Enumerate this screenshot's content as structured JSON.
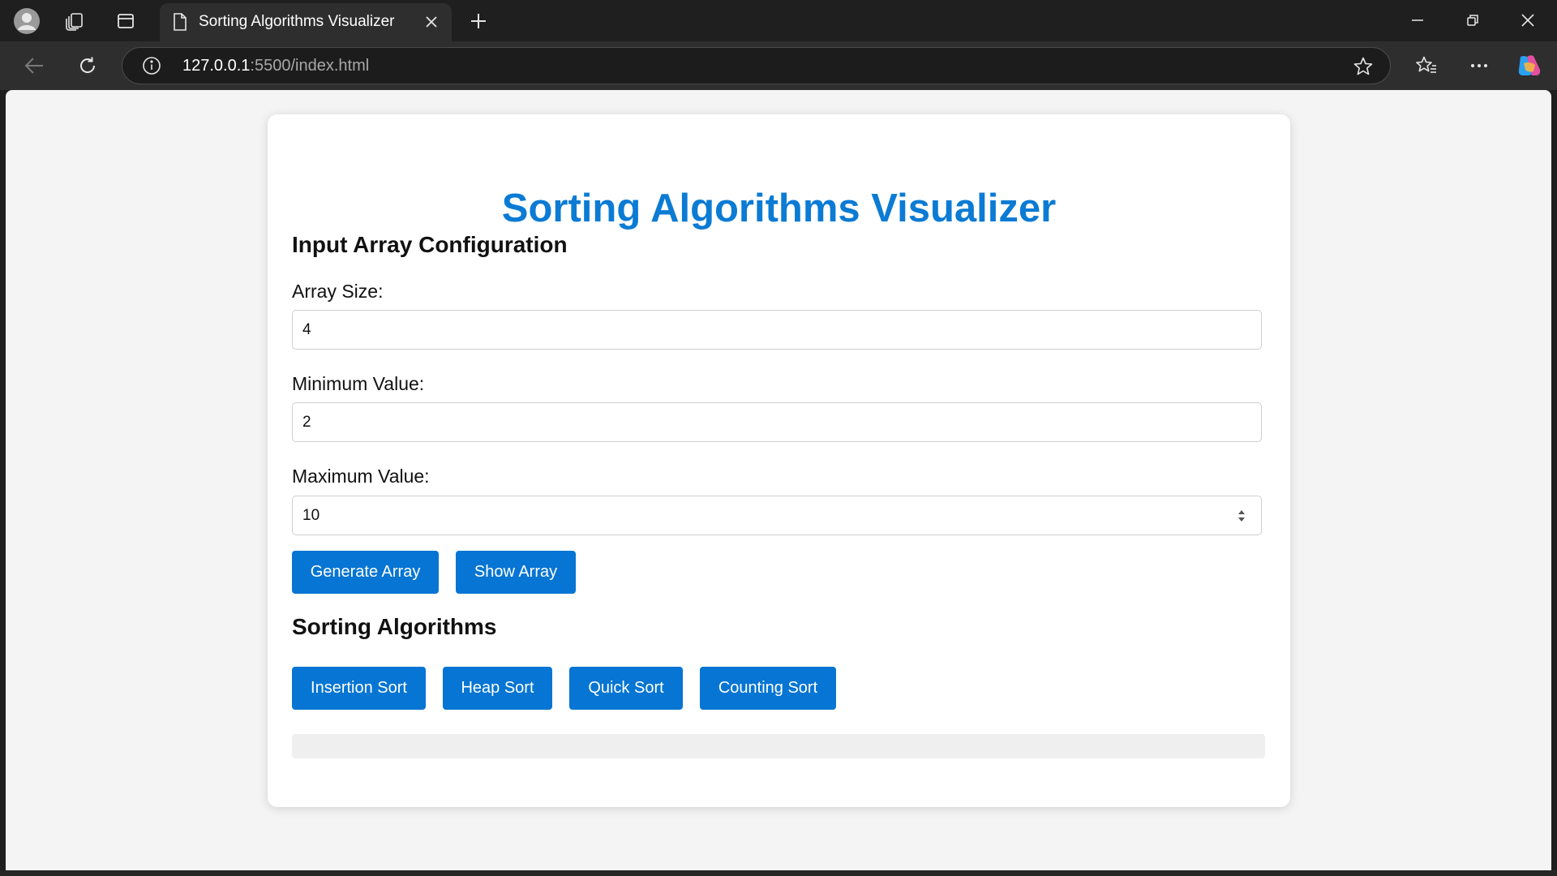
{
  "browser": {
    "tab": {
      "title": "Sorting Algorithms Visualizer"
    },
    "address": {
      "host": "127.0.0.1",
      "path": ":5500/index.html"
    }
  },
  "page": {
    "title": "Sorting Algorithms Visualizer",
    "config_section": "Input Array Configuration",
    "array_size": {
      "label": "Array Size:",
      "value": "4"
    },
    "min_value": {
      "label": "Minimum Value:",
      "value": "2"
    },
    "max_value": {
      "label": "Maximum Value:",
      "value": "10"
    },
    "actions": {
      "generate": "Generate Array",
      "show": "Show Array"
    },
    "algorithms_section": "Sorting Algorithms",
    "algorithms": {
      "insertion": "Insertion Sort",
      "heap": "Heap Sort",
      "quick": "Quick Sort",
      "counting": "Counting Sort"
    }
  },
  "colors": {
    "accent": "#0675d3",
    "title": "#0b7bd4",
    "page_bg": "#f4f4f4",
    "browser_chrome": "#1f1f1f"
  },
  "icons": [
    "profile-icon",
    "collections-icon",
    "tab-actions-icon",
    "page-icon",
    "close-icon",
    "new-tab-icon",
    "minimize-icon",
    "restore-icon",
    "window-close-icon",
    "back-icon",
    "refresh-icon",
    "info-icon",
    "favorite-star-icon",
    "favorites-icon",
    "more-icon",
    "copilot-icon"
  ]
}
